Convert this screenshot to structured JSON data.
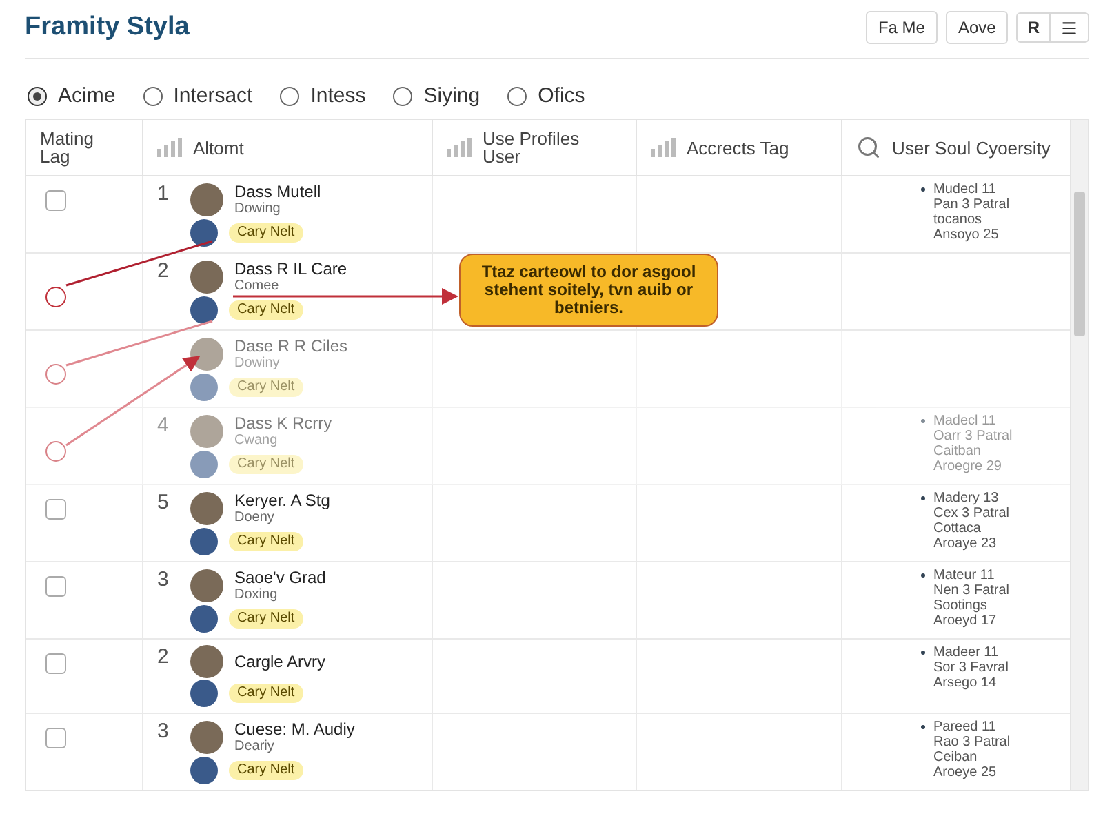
{
  "window": {
    "title": "Framity Styla"
  },
  "toolbar": {
    "buttons": [
      "Fa Me",
      "Aove"
    ],
    "icon_group": {
      "label": "R"
    }
  },
  "filters": [
    {
      "label": "Acime",
      "selected": true
    },
    {
      "label": "Intersact",
      "selected": false
    },
    {
      "label": "Intess",
      "selected": false
    },
    {
      "label": "Siying",
      "selected": false
    },
    {
      "label": "Ofics",
      "selected": false
    }
  ],
  "table": {
    "columns": [
      {
        "label": "Mating Lag"
      },
      {
        "label": "Altomt"
      },
      {
        "label": "Use Profiles User"
      },
      {
        "label": "Accrects Tag"
      },
      {
        "label": "User Soul Cyoersity"
      }
    ],
    "rows": [
      {
        "kind": "checkbox",
        "checked": false,
        "dimmed": false,
        "number": "1",
        "name": "Dass Mutell",
        "subtitle": "Dowing",
        "tag": "Cary Nelt",
        "notes": [
          "Mudecl 11",
          "Pan 3 Patral",
          "tocanos",
          "Ansoyo 25"
        ]
      },
      {
        "kind": "handle",
        "dimmed": false,
        "number": "2",
        "name": "Dass R IL Care",
        "subtitle": "Comee",
        "tag": "Cary Nelt",
        "notes": []
      },
      {
        "kind": "handle",
        "dimmed": true,
        "name": "Dase R R Ciles",
        "subtitle": "Dowiny",
        "tag": "Cary Nelt",
        "notes": []
      },
      {
        "kind": "handle",
        "dimmed": true,
        "number": "4",
        "name": "Dass K Rcrry",
        "subtitle": "Cwang",
        "tag": "Cary Nelt",
        "notes": [
          "Madecl 11",
          "Oarr 3 Patral",
          "Caitban",
          "Aroegre 29"
        ]
      },
      {
        "kind": "checkbox",
        "checked": false,
        "dimmed": false,
        "number": "5",
        "name": "Keryer. A Stg",
        "subtitle": "Doeny",
        "tag": "Cary Nelt",
        "notes": [
          "Madery 13",
          "Cex 3 Patral",
          "Cottaca",
          "Aroaye 23"
        ]
      },
      {
        "kind": "checkbox",
        "checked": false,
        "dimmed": false,
        "number": "3",
        "name": "Saoe'v Grad",
        "subtitle": "Doxing",
        "tag": "Cary Nelt",
        "notes": [
          "Mateur 11",
          "Nen 3 Fatral",
          "Sootings",
          "Aroeyd 17"
        ]
      },
      {
        "kind": "checkbox",
        "checked": false,
        "dimmed": false,
        "number": "2",
        "name": "Cargle Arvry",
        "tag": "Cary Nelt",
        "notes": [
          "Madeer 11",
          "Sor 3 Favral",
          "Arsego 14"
        ]
      },
      {
        "kind": "checkbox",
        "checked": false,
        "dimmed": false,
        "number": "3",
        "name": "Cuese: M. Audiy",
        "subtitle": "Deariy",
        "tag": "Cary Nelt",
        "notes": [
          "Pareed 11",
          "Rao 3 Patral",
          "Ceiban",
          "Aroeye 25"
        ]
      }
    ]
  },
  "callout": {
    "text": "Ttaz carteowl to dor asgool stehent soitely, tvn auib or betniers."
  }
}
